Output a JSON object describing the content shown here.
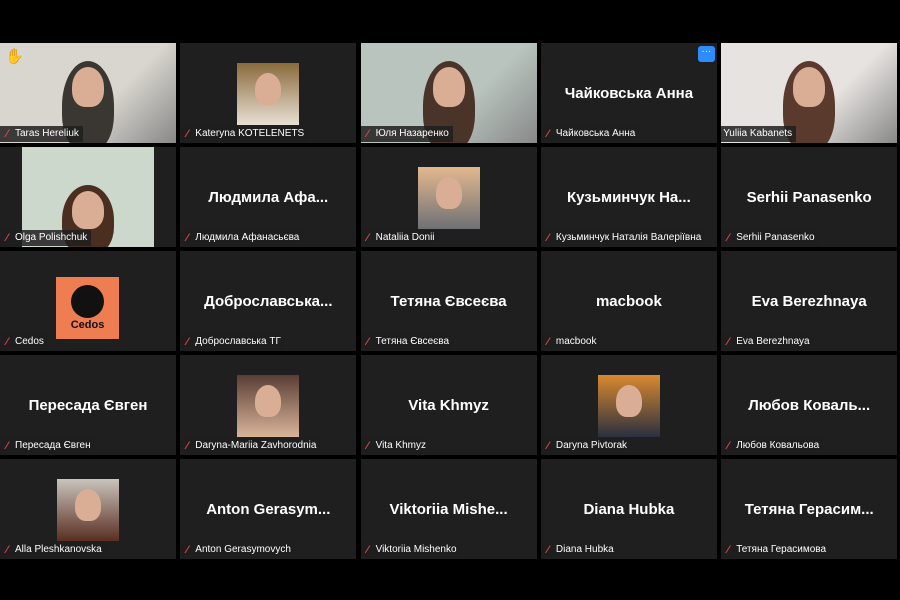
{
  "tiles": [
    {
      "label": "Taras Hereliuk",
      "type": "video",
      "muted": true,
      "raised_hand": true,
      "colors": [
        "#d9d6cf",
        "#3a3632"
      ]
    },
    {
      "label": "Kateryna KOTELENETS",
      "type": "avatar",
      "muted": true,
      "colors": [
        "#8a6a3c",
        "#e8e0d4"
      ]
    },
    {
      "label": "Юля Назаренко",
      "type": "video",
      "muted": true,
      "colors": [
        "#b9c4be",
        "#4a3328"
      ]
    },
    {
      "label": "Чайковська Анна",
      "display": "Чайковська Анна",
      "type": "name",
      "muted": true,
      "more_button": true
    },
    {
      "label": "Yuliia Kabanets",
      "type": "video",
      "muted": false,
      "active": true,
      "colors": [
        "#e6e3e0",
        "#5a3a2c"
      ]
    },
    {
      "label": "Olga Polishchuk",
      "type": "video-narrow",
      "muted": true,
      "colors": [
        "#cdd8cc",
        "#4a2e20"
      ]
    },
    {
      "label": "Людмила Афанасьєва",
      "display": "Людмила  Афа...",
      "type": "name",
      "muted": true
    },
    {
      "label": "Nataliia Donii",
      "type": "avatar",
      "muted": true,
      "colors": [
        "#e3b890",
        "#6f7074"
      ]
    },
    {
      "label": "Кузьминчук Наталія Валеріївна",
      "display": "Кузьминчук  На...",
      "type": "name",
      "muted": true
    },
    {
      "label": "Serhii Panasenko",
      "display": "Serhii Panasenko",
      "type": "name",
      "muted": true
    },
    {
      "label": "Cedos",
      "type": "logo",
      "logo_text": "Cedos",
      "muted": true
    },
    {
      "label": "Доброславська ТГ",
      "display": "Доброславська...",
      "type": "name",
      "muted": true
    },
    {
      "label": "Тетяна Євсеєва",
      "display": "Тетяна Євсеєва",
      "type": "name",
      "muted": true
    },
    {
      "label": "macbook",
      "display": "macbook",
      "type": "name",
      "muted": true
    },
    {
      "label": "Eva Berezhnaya",
      "display": "Eva Berezhnaya",
      "type": "name",
      "muted": true
    },
    {
      "label": "Пересада Євген",
      "display": "Пересада Євген",
      "type": "name",
      "muted": true
    },
    {
      "label": "Daryna-Mariia Zavhorodnia",
      "type": "avatar",
      "muted": true,
      "colors": [
        "#5a3e34",
        "#d9b49a"
      ]
    },
    {
      "label": "Vita Khmyz",
      "display": "Vita Khmyz",
      "type": "name",
      "muted": true
    },
    {
      "label": "Daryna Pivtorak",
      "type": "avatar",
      "muted": true,
      "colors": [
        "#d9892e",
        "#2a3040"
      ]
    },
    {
      "label": "Любов Ковальова",
      "display": "Любов  Коваль...",
      "type": "name",
      "muted": true
    },
    {
      "label": "Alla Pleshkanovska",
      "type": "avatar",
      "muted": true,
      "colors": [
        "#c9c4bc",
        "#5a2e22"
      ]
    },
    {
      "label": "Anton Gerasymovych",
      "display": "Anton  Gerasym...",
      "type": "name",
      "muted": true
    },
    {
      "label": "Viktoriia Mishenko",
      "display": "Viktoriia  Mishe...",
      "type": "name",
      "muted": true
    },
    {
      "label": "Diana Hubka",
      "display": "Diana Hubka",
      "type": "name",
      "muted": true
    },
    {
      "label": "Тетяна Герасимова",
      "display": "Тетяна  Герасим...",
      "type": "name",
      "muted": true
    }
  ]
}
